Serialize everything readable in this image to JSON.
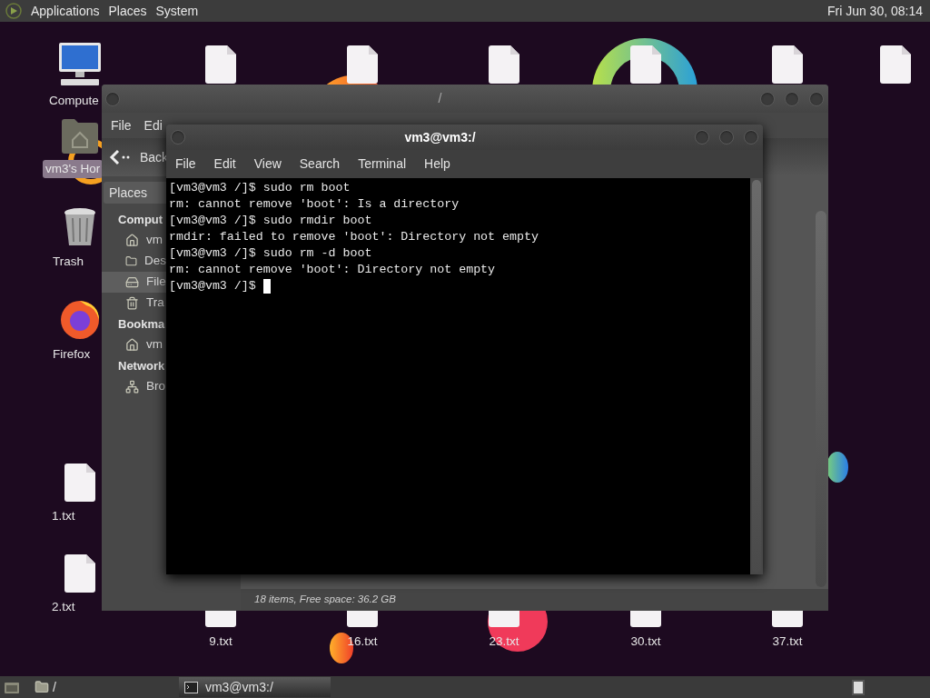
{
  "top_panel": {
    "menus": [
      "Applications",
      "Places",
      "System"
    ],
    "clock": "Fri Jun 30, 08:14"
  },
  "desktop_icons": [
    {
      "kind": "computer",
      "label": "Compute",
      "selected": false
    },
    {
      "kind": "home",
      "label": "vm3's Hor",
      "selected": true
    },
    {
      "kind": "trash",
      "label": "Trash",
      "selected": false
    },
    {
      "kind": "browser",
      "label": "Firefox",
      "selected": false
    },
    {
      "kind": "file",
      "label": "1.txt",
      "selected": false
    },
    {
      "kind": "file",
      "label": "2.txt",
      "selected": false
    }
  ],
  "top_row_files": [
    {
      "kind": "file"
    },
    {
      "kind": "file"
    },
    {
      "kind": "file"
    },
    {
      "kind": "file"
    },
    {
      "kind": "file"
    },
    {
      "kind": "file"
    }
  ],
  "bottom_row_files": [
    {
      "kind": "file",
      "label": "9.txt"
    },
    {
      "kind": "file",
      "label": "16.txt"
    },
    {
      "kind": "file",
      "label": "23.txt"
    },
    {
      "kind": "file",
      "label": "30.txt"
    },
    {
      "kind": "file",
      "label": "37.txt"
    }
  ],
  "file_manager": {
    "title": "/",
    "menus": [
      "File",
      "Edi"
    ],
    "back": "Back",
    "places_header": "Places",
    "sidebar": [
      {
        "kind": "header",
        "label": "Comput"
      },
      {
        "kind": "home",
        "label": "vm",
        "selected": false
      },
      {
        "kind": "desktop",
        "label": "Des",
        "selected": false
      },
      {
        "kind": "drive",
        "label": "File",
        "selected": true
      },
      {
        "kind": "trash",
        "label": "Tra",
        "selected": false
      },
      {
        "kind": "header",
        "label": "Bookma"
      },
      {
        "kind": "home",
        "label": "vm",
        "selected": false
      },
      {
        "kind": "header",
        "label": "Network"
      },
      {
        "kind": "network",
        "label": "Bro",
        "selected": false
      }
    ],
    "status": "18 items, Free space: 36.2 GB"
  },
  "terminal": {
    "title": "vm3@vm3:/",
    "menus": [
      "File",
      "Edit",
      "View",
      "Search",
      "Terminal",
      "Help"
    ],
    "lines": [
      "[vm3@vm3 /]$ sudo rm boot",
      "rm: cannot remove 'boot': Is a directory",
      "[vm3@vm3 /]$ sudo rmdir boot",
      "rmdir: failed to remove 'boot': Directory not empty",
      "[vm3@vm3 /]$ sudo rm -d boot",
      "rm: cannot remove 'boot': Directory not empty"
    ],
    "prompt": "[vm3@vm3 /]$ ",
    "cursor": true
  },
  "taskbar": {
    "path": "/",
    "tasks": [
      {
        "label": "vm3@vm3:/",
        "selected": true
      }
    ]
  }
}
